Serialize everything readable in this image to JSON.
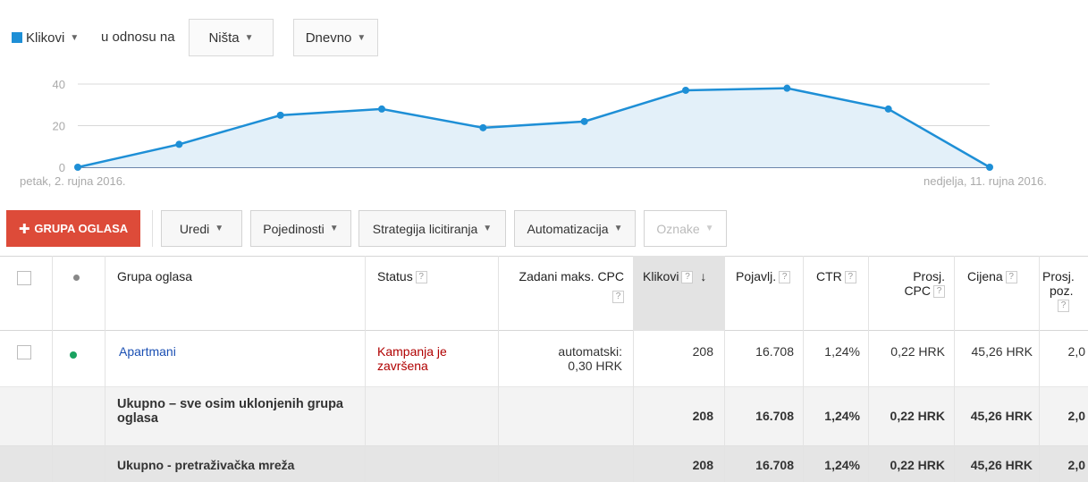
{
  "controls": {
    "metric1": "Klikovi",
    "relation_text": "u odnosu na",
    "metric2": "Ništa",
    "period": "Dnevno"
  },
  "chart_data": {
    "type": "area",
    "x": [
      "2016-09-02",
      "2016-09-03",
      "2016-09-04",
      "2016-09-05",
      "2016-09-06",
      "2016-09-07",
      "2016-09-08",
      "2016-09-09",
      "2016-09-10",
      "2016-09-11"
    ],
    "series": [
      {
        "values": [
          0,
          11,
          25,
          28,
          19,
          22,
          37,
          38,
          28,
          0
        ]
      }
    ],
    "ylim": [
      0,
      40
    ],
    "yticks": [
      "40",
      "20",
      "0"
    ],
    "grid": true,
    "color": "#1e8fd6",
    "fill": "#e3f0f9",
    "start_label": "petak, 2. rujna 2016.",
    "end_label": "nedjelja, 11. rujna 2016."
  },
  "toolbar": {
    "add_button": "GRUPA OGLASA",
    "edit": "Uredi",
    "details": "Pojedinosti",
    "bid_strategy": "Strategija licitiranja",
    "automation": "Automatizacija",
    "labels": "Oznake"
  },
  "table": {
    "headers": {
      "group": "Grupa oglasa",
      "status": "Status",
      "default_cpc": "Zadani maks. CPC",
      "clicks": "Klikovi",
      "impressions": "Pojavlj.",
      "ctr": "CTR",
      "avg_cpc_1": "Prosj.",
      "avg_cpc_2": "CPC",
      "cost": "Cijena",
      "avg_pos_1": "Prosj.",
      "avg_pos_2": "poz."
    },
    "help_mark": "?",
    "sort_arrow": "↓",
    "row": {
      "name": "Apartmani",
      "status_1": "Kampanja je",
      "status_2": "završena",
      "cpc_1": "automatski:",
      "cpc_2": "0,30 HRK",
      "clicks": "208",
      "impressions": "16.708",
      "ctr": "1,24%",
      "avg_cpc": "0,22 HRK",
      "cost": "45,26 HRK",
      "avg_pos": "2,0"
    },
    "total_all": {
      "label_1": "Ukupno – sve osim uklonjenih grupa",
      "label_2": "oglasa",
      "clicks": "208",
      "impressions": "16.708",
      "ctr": "1,24%",
      "avg_cpc": "0,22 HRK",
      "cost": "45,26 HRK",
      "avg_pos": "2,0"
    },
    "total_search": {
      "label": "Ukupno - pretraživačka mreža",
      "clicks": "208",
      "impressions": "16.708",
      "ctr": "1,24%",
      "avg_cpc": "0,22 HRK",
      "cost": "45,26 HRK",
      "avg_pos": "2,0"
    }
  }
}
